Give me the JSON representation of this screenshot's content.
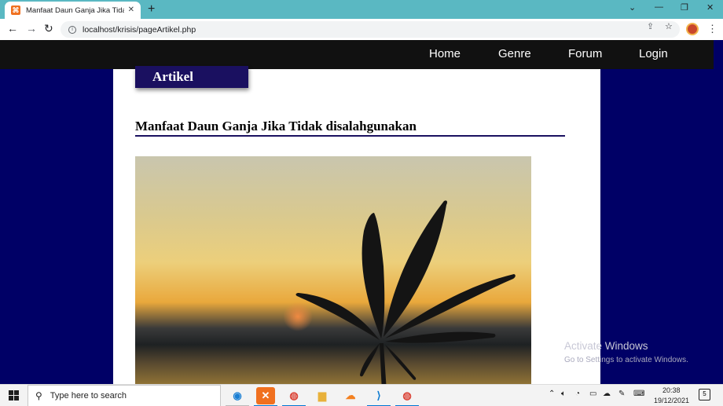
{
  "browser": {
    "tab_title": "Manfaat Daun Ganja Jika Tidak disalahgunakan",
    "tab_favicon": "xampp-icon",
    "url": "localhost/krisis/pageArtikel.php"
  },
  "site_nav": {
    "items": [
      "Home",
      "Genre",
      "Forum",
      "Login"
    ]
  },
  "page": {
    "section_tag": "Artikel",
    "article_title": "Manfaat Daun Ganja Jika Tidak disalahgunakan",
    "image_subject": "cannabis-leaf-silhouette-sunset"
  },
  "watermark": {
    "title": "Activate Windows",
    "subtitle": "Go to Settings to activate Windows."
  },
  "taskbar": {
    "search_placeholder": "Type here to search",
    "time": "20:38",
    "date": "19/12/2021",
    "notification_count": "5"
  },
  "colors": {
    "page_bg": "#000066",
    "navbar_bg": "#111111",
    "section_tag_bg": "#1a1060",
    "browser_frame": "#5ab8c2"
  }
}
